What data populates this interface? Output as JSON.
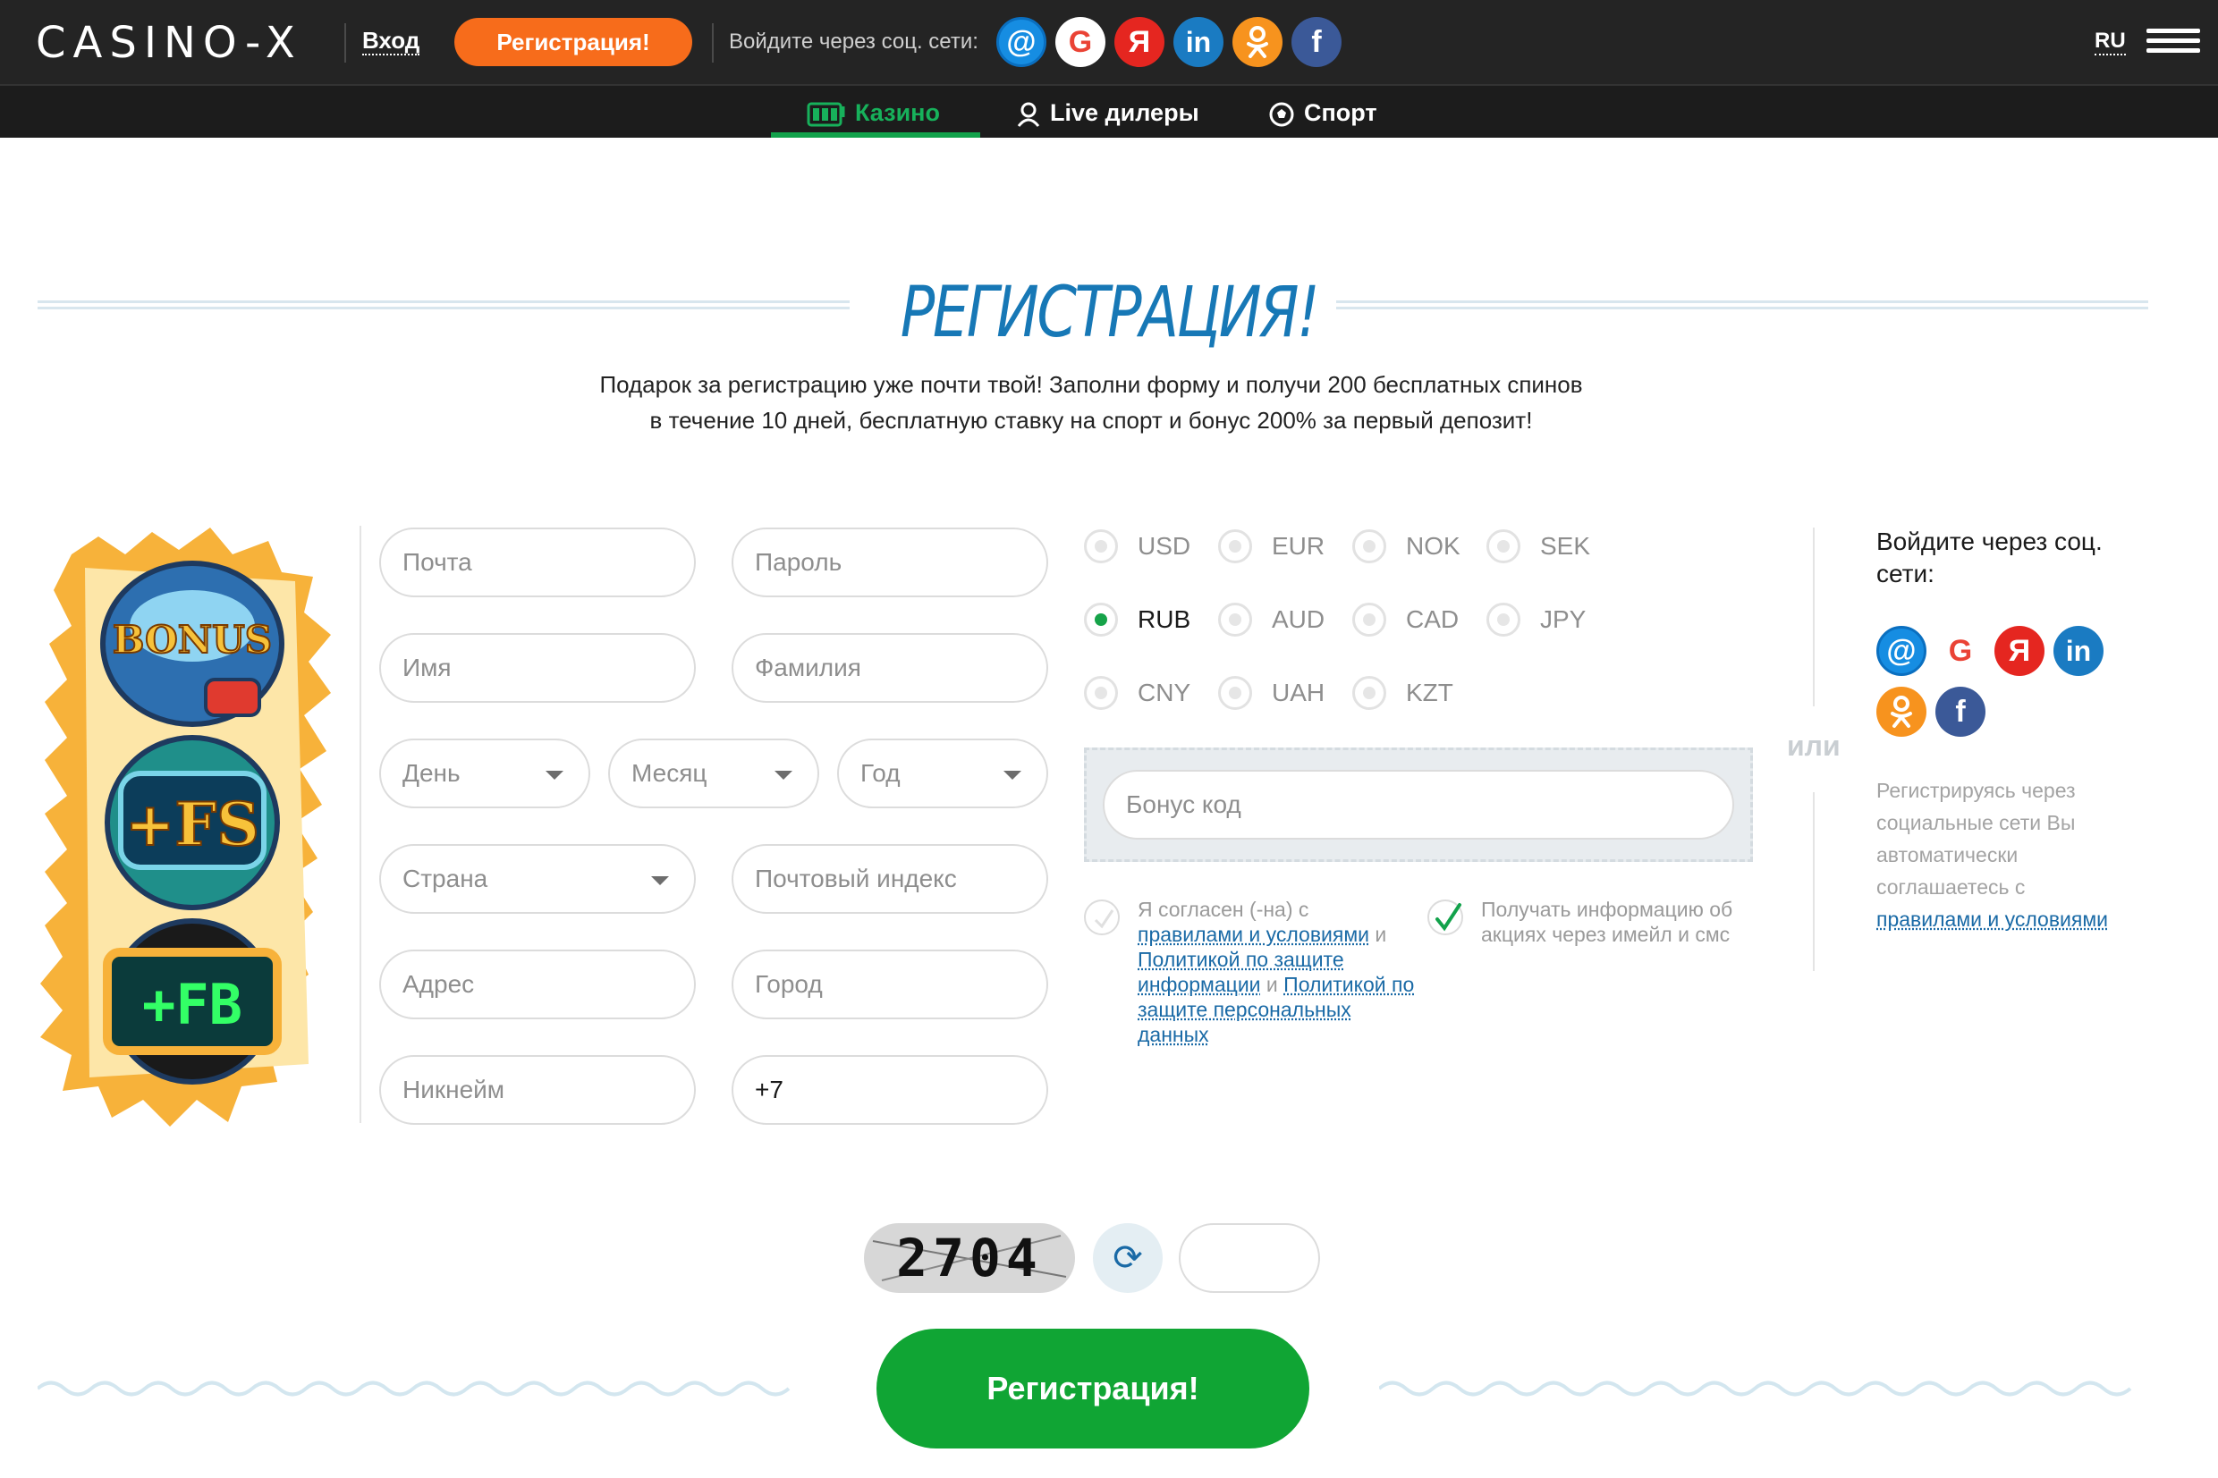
{
  "header": {
    "logo": "CASINO-X",
    "login_label": "Вход",
    "register_label": "Регистрация!",
    "social_label": "Войдите через соц. сети:",
    "social_icons": [
      "mail-ru-icon",
      "google-icon",
      "yandex-icon",
      "linkedin-icon",
      "odnoklassniki-icon",
      "facebook-icon"
    ],
    "lang": "RU"
  },
  "nav": {
    "items": [
      {
        "label": "Казино",
        "icon": "slot-machine-icon",
        "active": true
      },
      {
        "label": "Live дилеры",
        "icon": "dealer-icon",
        "active": false
      },
      {
        "label": "Спорт",
        "icon": "football-icon",
        "active": false
      }
    ]
  },
  "page": {
    "title": "РЕГИСТРАЦИЯ!",
    "intro": "Подарок за регистрацию уже почти твой! Заполни форму и получи 200 бесплатных спинов в течение 10 дней, бесплатную ставку на спорт и бонус 200% за первый депозит!"
  },
  "art": {
    "badges": [
      "BONUS",
      "+FS",
      "+FB"
    ]
  },
  "form": {
    "email_placeholder": "Почта",
    "password_placeholder": "Пароль",
    "first_name_placeholder": "Имя",
    "last_name_placeholder": "Фамилия",
    "day_placeholder": "День",
    "month_placeholder": "Месяц",
    "year_placeholder": "Год",
    "country_placeholder": "Страна",
    "zip_placeholder": "Почтовый индекс",
    "address_placeholder": "Адрес",
    "city_placeholder": "Город",
    "nickname_placeholder": "Никнейм",
    "phone_value": "+7",
    "currencies": [
      "USD",
      "EUR",
      "NOK",
      "SEK",
      "RUB",
      "AUD",
      "CAD",
      "JPY",
      "CNY",
      "UAH",
      "KZT"
    ],
    "selected_currency": "RUB",
    "bonus_code_placeholder": "Бонус код",
    "or_label": "или",
    "agree": {
      "prefix": "Я согласен (-на) с ",
      "link1": "правилами и условиями",
      "and1": " и ",
      "link2": "Политикой по защите информации",
      "and2": " и ",
      "link3": "Политикой по защите персональных данных",
      "checked": false
    },
    "newsletter": {
      "text": "Получать информацию об акциях через имейл и смс",
      "checked": true
    },
    "captcha_text": "2704",
    "submit_label": "Регистрация!"
  },
  "right": {
    "title": "Войдите через соц. сети:",
    "social_icons": [
      "mail-ru-icon",
      "google-icon",
      "yandex-icon",
      "linkedin-icon",
      "odnoklassniki-icon",
      "facebook-icon"
    ],
    "note": "Регистрируясь через социальные сети Вы автоматически соглашаетесь с ",
    "note_link": "правилами и условиями"
  },
  "colors": {
    "accent_orange": "#f76c1b",
    "accent_green": "#10a534",
    "title_blue": "#1778b6",
    "link_blue": "#1a6aa6",
    "header_bg": "#242424"
  }
}
